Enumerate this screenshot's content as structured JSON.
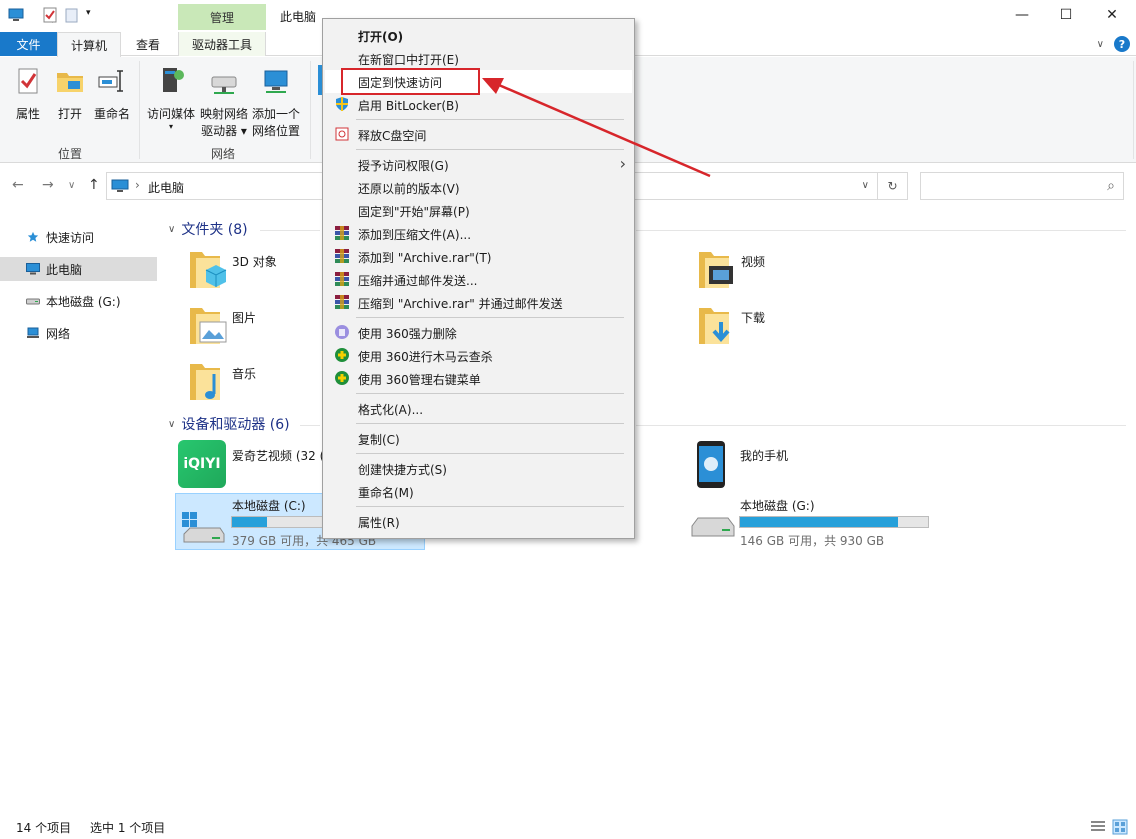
{
  "window": {
    "title": "此电脑",
    "context_tab": "管理",
    "controls": {
      "minimize": "—",
      "maximize": "☐",
      "close": "✕"
    }
  },
  "ribbon": {
    "tabs": {
      "file": "文件",
      "computer": "计算机",
      "view": "查看",
      "drive_tools": "驱动器工具"
    },
    "groups": {
      "location": {
        "label": "位置",
        "buttons": {
          "properties": "属性",
          "open": "打开",
          "rename": "重命名"
        }
      },
      "network": {
        "label": "网络",
        "buttons": {
          "access_media": "访问媒体",
          "map_drive_1": "映射网络",
          "map_drive_2": "驱动器",
          "add_location_1": "添加一个",
          "add_location_2": "网络位置"
        }
      }
    },
    "expand_arrow": "∨",
    "help": "?"
  },
  "nav": {
    "back": "←",
    "forward": "→",
    "recent": "∨",
    "up": "↑",
    "breadcrumb_sep": "›",
    "address": "此电脑",
    "dropdown": "∨",
    "refresh": "↻",
    "search_placeholder": "",
    "search_icon": "⌕"
  },
  "sidebar": {
    "items": [
      {
        "label": "快速访问",
        "icon": "star-icon"
      },
      {
        "label": "此电脑",
        "icon": "computer-icon"
      },
      {
        "label": "本地磁盘 (G:)",
        "icon": "drive-icon"
      },
      {
        "label": "网络",
        "icon": "network-icon"
      }
    ]
  },
  "content": {
    "folders_header": "文件夹 (8)",
    "folders": {
      "objects3d": "3D 对象",
      "videos": "视频",
      "pictures": "图片",
      "downloads": "下载",
      "music": "音乐"
    },
    "devices_header": "设备和驱动器 (6)",
    "devices": {
      "iqiyi": {
        "label": "爱奇艺视频 (32 (",
        "logo_text": "iQIYI"
      },
      "phone": "我的手机",
      "drive_c": {
        "label": "本地磁盘 (C:)",
        "free": "379 GB 可用，共 465 GB",
        "used_fraction": 0.185
      },
      "drive_g": {
        "label": "本地磁盘 (G:)",
        "free": "146 GB 可用，共 930 GB",
        "used_fraction": 0.843
      }
    }
  },
  "status": {
    "count": "14 个项目",
    "selected": "选中 1 个项目"
  },
  "context_menu": {
    "open": "打开(O)",
    "open_new_window": "在新窗口中打开(E)",
    "pin_quick_access": "固定到快速访问",
    "bitlocker": "启用 BitLocker(B)",
    "free_c": "释放C盘空间",
    "grant_access": "授予访问权限(G)",
    "restore_versions": "还原以前的版本(V)",
    "pin_start": "固定到\"开始\"屏幕(P)",
    "add_archive": "添加到压缩文件(A)...",
    "add_rar": "添加到 \"Archive.rar\"(T)",
    "compress_email": "压缩并通过邮件发送...",
    "compress_rar_email": "压缩到 \"Archive.rar\" 并通过邮件发送",
    "del_360": "使用 360强力删除",
    "scan_360": "使用 360进行木马云查杀",
    "manage_360": "使用 360管理右键菜单",
    "format": "格式化(A)...",
    "copy": "复制(C)",
    "create_shortcut": "创建快捷方式(S)",
    "rename": "重命名(M)",
    "properties": "属性(R)",
    "submenu_arrow": "›"
  }
}
